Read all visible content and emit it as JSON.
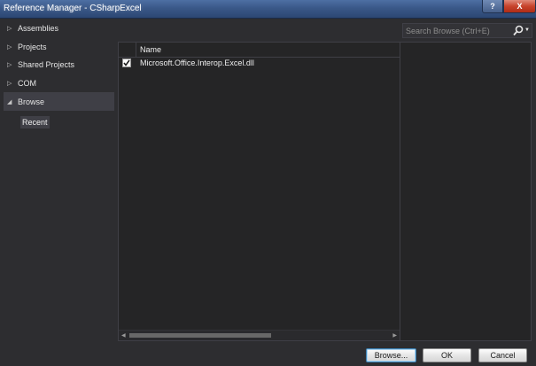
{
  "window": {
    "title": "Reference Manager - CSharpExcel",
    "help_label": "?",
    "close_label": "X"
  },
  "sidebar": {
    "items": [
      {
        "label": "Assemblies",
        "arrow": "▷"
      },
      {
        "label": "Projects",
        "arrow": "▷"
      },
      {
        "label": "Shared Projects",
        "arrow": "▷"
      },
      {
        "label": "COM",
        "arrow": "▷"
      },
      {
        "label": "Browse",
        "arrow": "◢"
      }
    ],
    "sub_item": "Recent"
  },
  "search": {
    "placeholder": "Search Browse (Ctrl+E)",
    "icon": "search-icon"
  },
  "list": {
    "columns": [
      "",
      "Name"
    ],
    "rows": [
      {
        "checked": true,
        "name": "Microsoft.Office.Interop.Excel.dll"
      }
    ]
  },
  "buttons": {
    "browse": "Browse...",
    "ok": "OK",
    "cancel": "Cancel"
  },
  "colors": {
    "background": "#2d2d30",
    "panel": "#252526",
    "selected": "#3f3f46",
    "text": "#e6e6e6"
  }
}
